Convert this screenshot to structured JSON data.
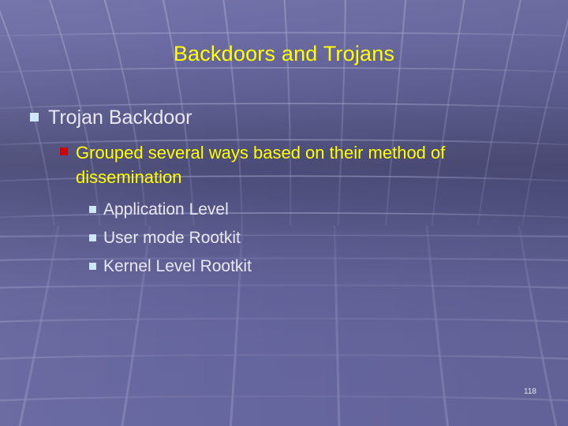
{
  "slide": {
    "title": "Backdoors and Trojans",
    "page_number": "118",
    "colors": {
      "title_text": "#ffff00",
      "body_text": "#e8e8f5",
      "highlight_text": "#ffff00",
      "marker_blue": "#cfe7fb",
      "marker_red": "#cc0000",
      "background_top": "#7171a8",
      "background_mid": "#4c4c78",
      "background_bottom": "#6767a0",
      "grid_line": "#8a8ab8"
    },
    "bullets": [
      {
        "level": 1,
        "marker": "square-bullet-blue",
        "text": "Trojan Backdoor"
      },
      {
        "level": 2,
        "marker": "square-bullet-red",
        "text": "Grouped several ways based on their method of dissemination"
      },
      {
        "level": 3,
        "marker": "square-bullet-blue",
        "text": "Application Level"
      },
      {
        "level": 3,
        "marker": "square-bullet-blue",
        "text": "User mode Rootkit"
      },
      {
        "level": 3,
        "marker": "square-bullet-blue",
        "text": "Kernel Level Rootkit"
      }
    ]
  }
}
